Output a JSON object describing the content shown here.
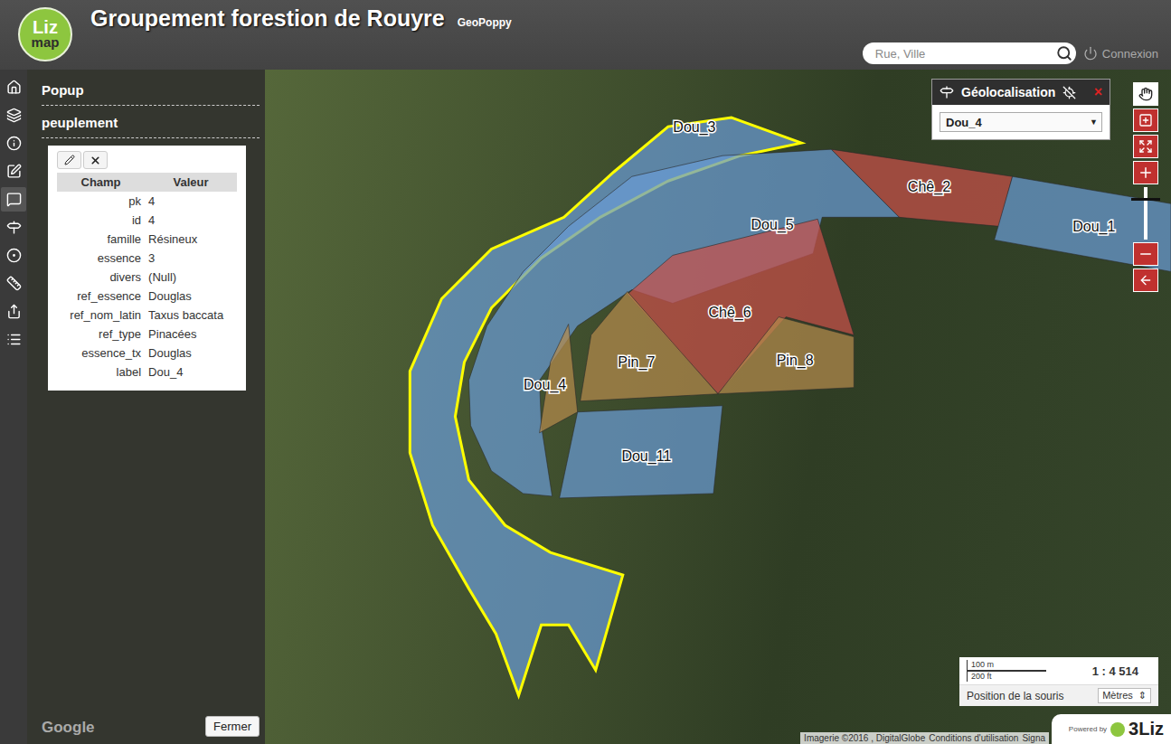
{
  "header": {
    "logo_top": "Liz",
    "logo_bottom": "map",
    "title": "Groupement forestion de Rouyre",
    "subtitle": "GeoPoppy",
    "search_placeholder": "Rue, Ville",
    "login": "Connexion"
  },
  "sidebar": {
    "items": [
      {
        "selected": false
      },
      {
        "selected": false
      },
      {
        "selected": false
      },
      {
        "selected": false
      },
      {
        "selected": true
      },
      {
        "selected": false
      },
      {
        "selected": false
      },
      {
        "selected": false
      },
      {
        "selected": false
      },
      {
        "selected": false
      }
    ]
  },
  "panel": {
    "title": "Popup",
    "layer": "peuplement",
    "columns": [
      "Champ",
      "Valeur"
    ],
    "rows": [
      [
        "pk",
        "4"
      ],
      [
        "id",
        "4"
      ],
      [
        "famille",
        "Résineux"
      ],
      [
        "essence",
        "3"
      ],
      [
        "divers",
        "(Null)"
      ],
      [
        "ref_essence",
        "Douglas"
      ],
      [
        "ref_nom_latin",
        "Taxus baccata"
      ],
      [
        "ref_type",
        "Pinacées"
      ],
      [
        "essence_tx",
        "Douglas"
      ],
      [
        "label",
        "Dou_4"
      ]
    ],
    "close_button": "Fermer",
    "watermark": "Google"
  },
  "geolocation": {
    "title": "Géolocalisation",
    "close": "×",
    "selected_value": "Dou_4"
  },
  "zoom_slider": {
    "level": 0.8
  },
  "parcels": [
    {
      "label": "Dou_3",
      "color": "#6a9bd4",
      "selected": true
    },
    {
      "label": "Chê_2",
      "color": "#c9504a",
      "selected": false
    },
    {
      "label": "Dou_1",
      "color": "#6a9bd4",
      "selected": false
    },
    {
      "label": "Dou_5",
      "color": "#6a9bd4",
      "selected": false
    },
    {
      "label": "Chê_6",
      "color": "#c9504a",
      "selected": false
    },
    {
      "label": "Pin_7",
      "color": "#b48a4c",
      "selected": false
    },
    {
      "label": "Pin_8",
      "color": "#b48a4c",
      "selected": false
    },
    {
      "label": "Dou_4",
      "color": "#b48a4c",
      "selected": false
    },
    {
      "label": "Dou_11",
      "color": "#6a9bd4",
      "selected": false
    }
  ],
  "scale": {
    "metric": "100 m",
    "imperial": "200 ft",
    "ratio": "1 : 4 514",
    "mouse_label": "Position de la souris",
    "unit": "Mètres"
  },
  "attribution": [
    "Imagerie ©2016 , DigitalGlobe",
    "Conditions d'utilisation",
    "Signa"
  ],
  "powered": {
    "by": "Powered by",
    "brand": "3Liz"
  }
}
